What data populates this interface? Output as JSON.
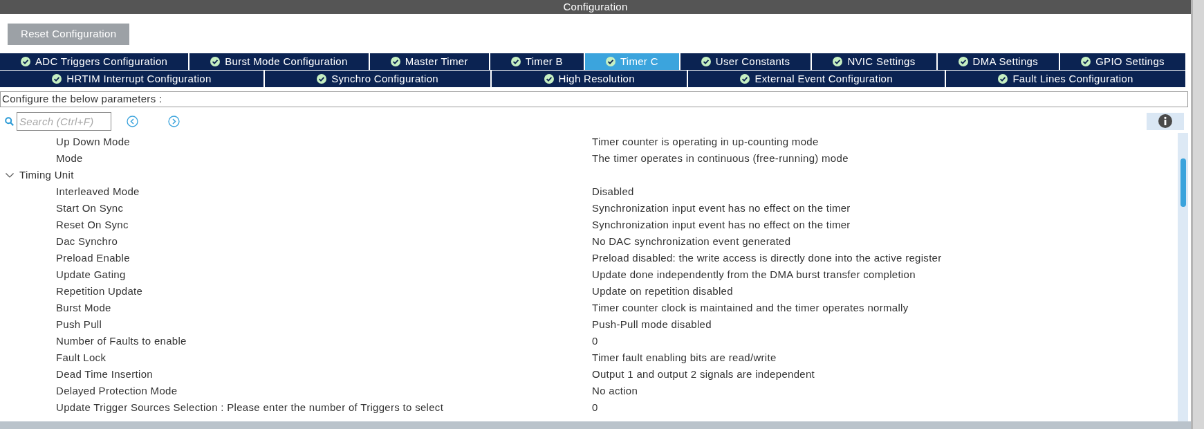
{
  "window": {
    "title": "Configuration"
  },
  "toolbar": {
    "reset_button": "Reset Configuration"
  },
  "tab_rows": [
    {
      "tabs": [
        {
          "label": "ADC Triggers Configuration",
          "selected": false
        },
        {
          "label": "Burst Mode Configuration",
          "selected": false
        },
        {
          "label": "Master Timer",
          "selected": false
        },
        {
          "label": "Timer B",
          "selected": false
        },
        {
          "label": "Timer C",
          "selected": true
        },
        {
          "label": "User Constants",
          "selected": false
        },
        {
          "label": "NVIC Settings",
          "selected": false
        },
        {
          "label": "DMA Settings",
          "selected": false
        },
        {
          "label": "GPIO Settings",
          "selected": false
        }
      ]
    },
    {
      "tabs": [
        {
          "label": "HRTIM Interrupt Configuration",
          "selected": false
        },
        {
          "label": "Synchro Configuration",
          "selected": false
        },
        {
          "label": "High Resolution",
          "selected": false
        },
        {
          "label": "External Event Configuration",
          "selected": false
        },
        {
          "label": "Fault Lines Configuration",
          "selected": false
        }
      ]
    }
  ],
  "description": "Configure the below parameters :",
  "search": {
    "placeholder": "Search (Ctrl+F)"
  },
  "parameters": [
    {
      "kind": "parameter",
      "label": "Up Down Mode",
      "value": "Timer counter is operating in up-counting mode"
    },
    {
      "kind": "parameter",
      "label": "Mode",
      "value": "The timer operates in continuous (free-running) mode"
    },
    {
      "kind": "group",
      "label": "Timing Unit",
      "expanded": true,
      "children": [
        {
          "kind": "parameter",
          "label": "Interleaved Mode",
          "value": "Disabled"
        },
        {
          "kind": "parameter",
          "label": "Start On Sync",
          "value": "Synchronization input event has no effect on the timer"
        },
        {
          "kind": "parameter",
          "label": "Reset On Sync",
          "value": "Synchronization input event has no effect on the timer"
        },
        {
          "kind": "parameter",
          "label": "Dac Synchro",
          "value": "No DAC synchronization event generated"
        },
        {
          "kind": "parameter",
          "label": "Preload Enable",
          "value": "Preload disabled: the write access is directly done into the active register"
        },
        {
          "kind": "parameter",
          "label": "Update Gating",
          "value": "Update done independently from the DMA burst transfer completion"
        },
        {
          "kind": "parameter",
          "label": "Repetition Update",
          "value": "Update on repetition disabled"
        },
        {
          "kind": "parameter",
          "label": "Burst Mode",
          "value": "Timer counter clock is maintained and the timer operates normally"
        },
        {
          "kind": "parameter",
          "label": "Push Pull",
          "value": "Push-Pull mode disabled"
        },
        {
          "kind": "parameter",
          "label": "Number of Faults to enable",
          "value": "0"
        },
        {
          "kind": "parameter",
          "label": "Fault Lock",
          "value": "Timer fault enabling bits are read/write"
        },
        {
          "kind": "parameter",
          "label": "Dead Time Insertion",
          "value": "Output 1 and output 2 signals are independent"
        },
        {
          "kind": "parameter",
          "label": "Delayed Protection Mode",
          "value": "No action"
        },
        {
          "kind": "parameter",
          "label": "Update Trigger Sources Selection : Please enter the number of Triggers to select",
          "value": "0"
        }
      ]
    }
  ]
}
